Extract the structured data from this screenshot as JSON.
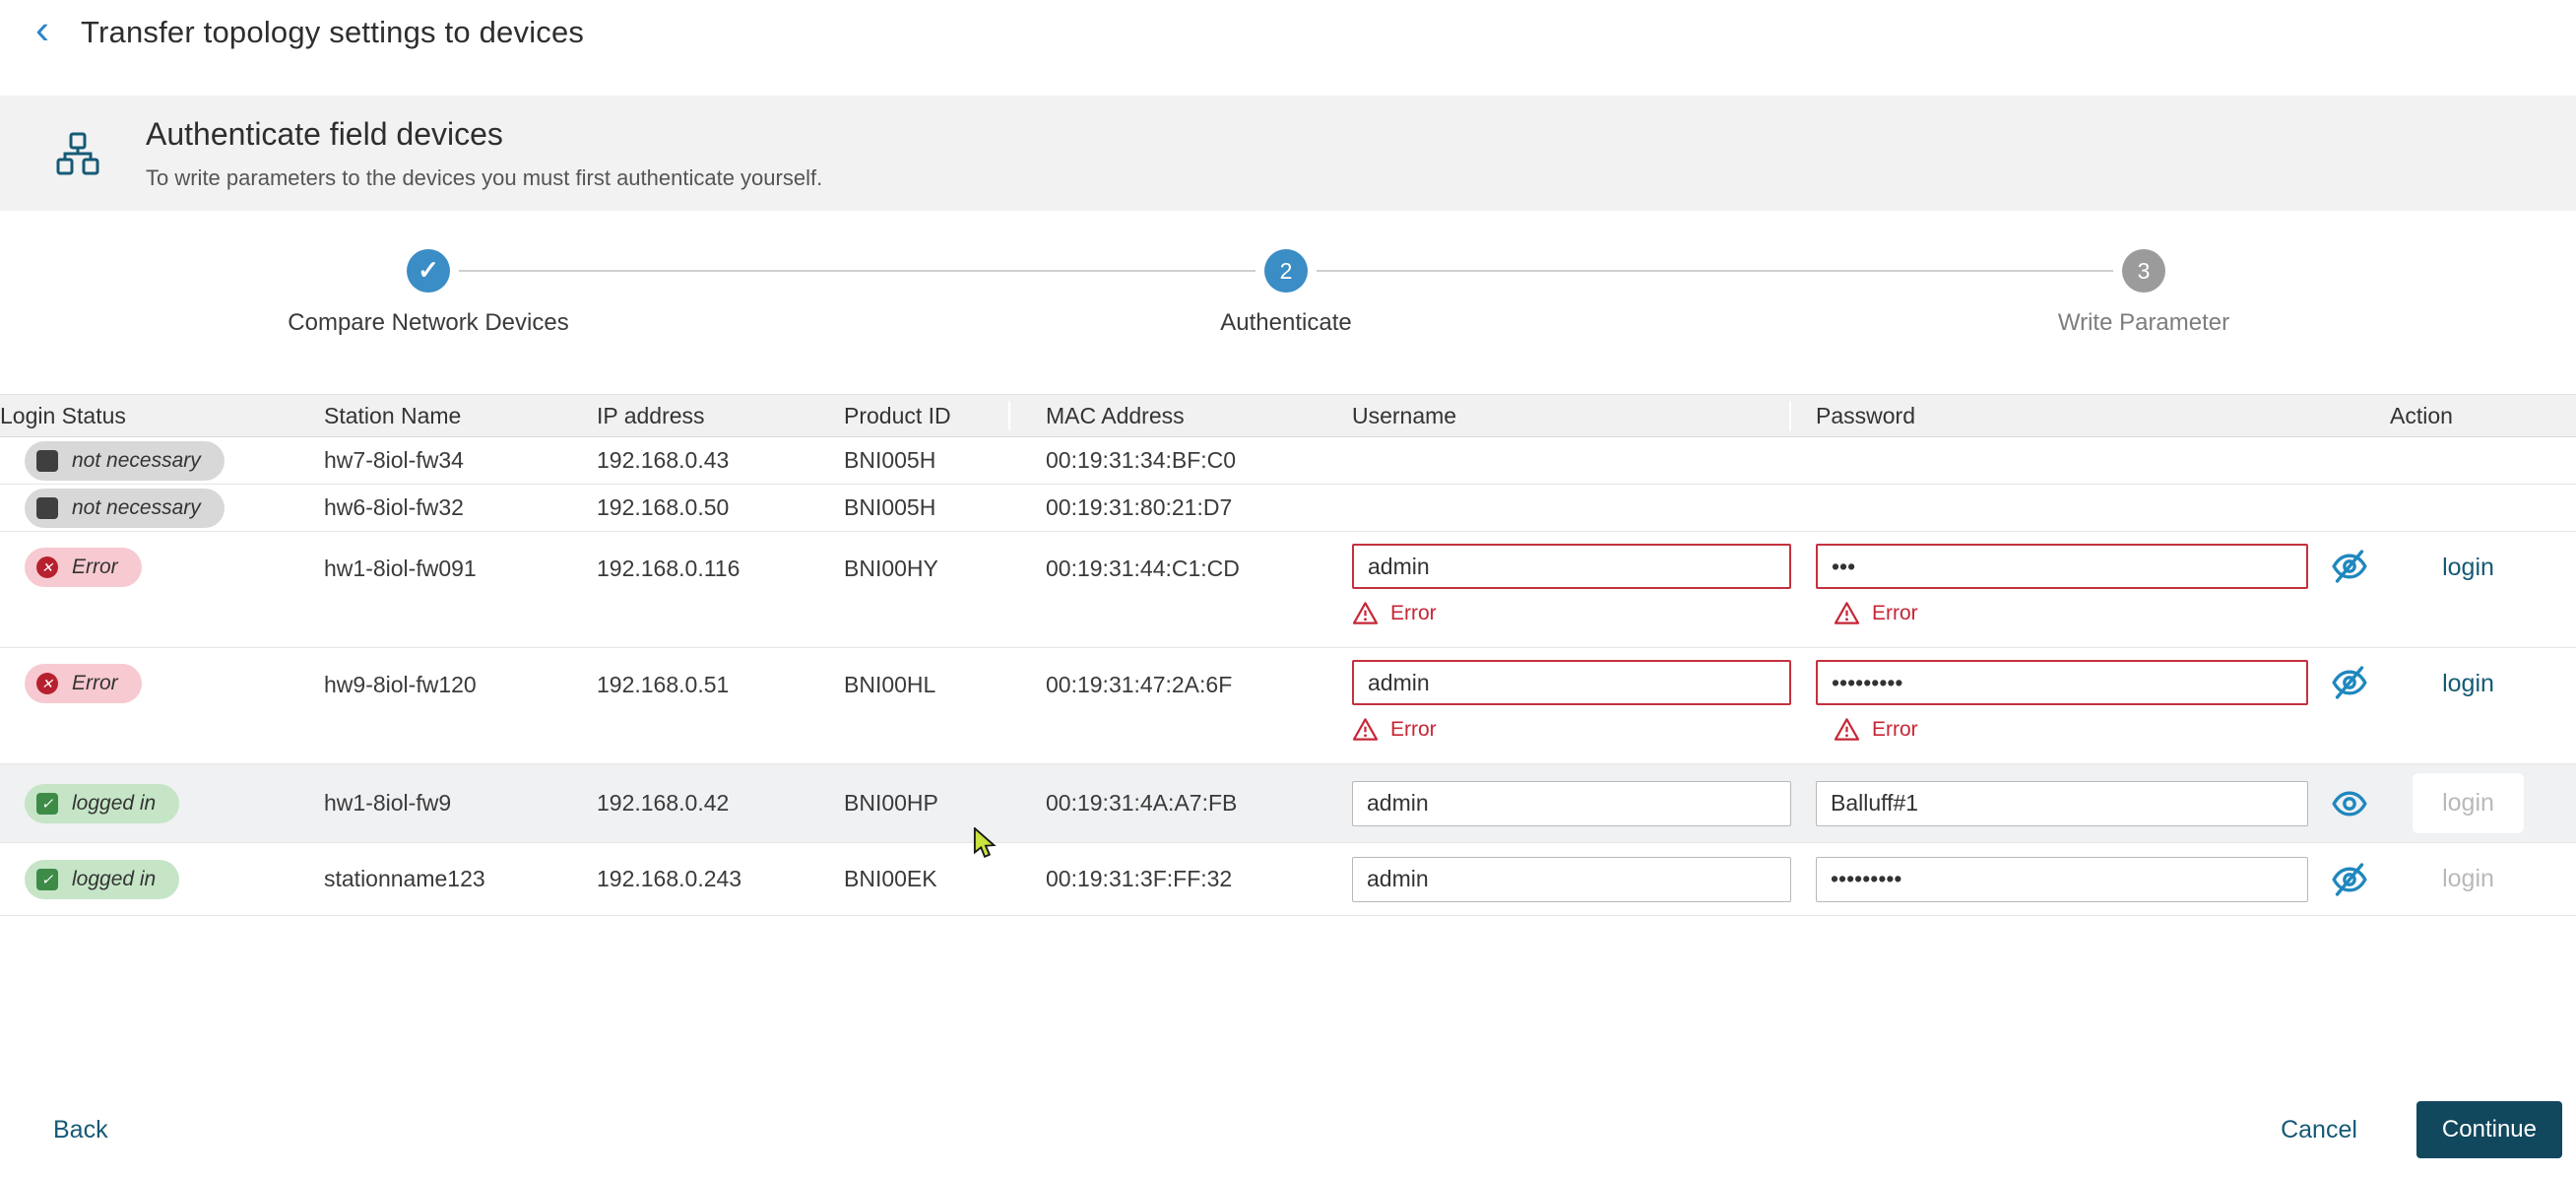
{
  "header": {
    "title": "Transfer topology settings to devices"
  },
  "banner": {
    "title": "Authenticate field devices",
    "subtitle": "To write parameters to the devices you must first authenticate yourself."
  },
  "stepper": {
    "steps": [
      {
        "label": "Compare Network Devices",
        "state": "done",
        "number": "1"
      },
      {
        "label": "Authenticate",
        "state": "active",
        "number": "2"
      },
      {
        "label": "Write Parameter",
        "state": "upcoming",
        "number": "3"
      }
    ]
  },
  "table": {
    "columns": [
      "Login Status",
      "Station Name",
      "IP address",
      "Product ID",
      "MAC Address",
      "Username",
      "Password",
      "Action"
    ],
    "rows": [
      {
        "status": {
          "label": "not necessary",
          "type": "not-necessary"
        },
        "station": "hw7-8iol-fw34",
        "ip": "192.168.0.43",
        "product": "BNI005H",
        "mac": "00:19:31:34:BF:C0",
        "username": null,
        "password": null,
        "eye": null,
        "action": null,
        "height": "h48",
        "highlight": false
      },
      {
        "status": {
          "label": "not necessary",
          "type": "not-necessary"
        },
        "station": "hw6-8iol-fw32",
        "ip": "192.168.0.50",
        "product": "BNI005H",
        "mac": "00:19:31:80:21:D7",
        "username": null,
        "password": null,
        "eye": null,
        "action": null,
        "height": "h48",
        "highlight": false
      },
      {
        "status": {
          "label": "Error",
          "type": "error"
        },
        "station": "hw1-8iol-fw091",
        "ip": "192.168.0.116",
        "product": "BNI00HY",
        "mac": "00:19:31:44:C1:CD",
        "username": {
          "value": "admin",
          "error": "Error"
        },
        "password": {
          "value": "•••",
          "error": "Error"
        },
        "eye": "eye-off",
        "action": {
          "label": "login",
          "enabled": true,
          "boxed": false
        },
        "height": "h118",
        "highlight": false
      },
      {
        "status": {
          "label": "Error",
          "type": "error"
        },
        "station": "hw9-8iol-fw120",
        "ip": "192.168.0.51",
        "product": "BNI00HL",
        "mac": "00:19:31:47:2A:6F",
        "username": {
          "value": "admin",
          "error": "Error"
        },
        "password": {
          "value": "•••••••••",
          "error": "Error"
        },
        "eye": "eye-off",
        "action": {
          "label": "login",
          "enabled": true,
          "boxed": false
        },
        "height": "h118",
        "highlight": false
      },
      {
        "status": {
          "label": "logged in",
          "type": "logged-in"
        },
        "station": "hw1-8iol-fw9",
        "ip": "192.168.0.42",
        "product": "BNI00HP",
        "mac": "00:19:31:4A:A7:FB",
        "username": {
          "value": "admin",
          "error": null
        },
        "password": {
          "value": "Balluff#1",
          "error": null
        },
        "eye": "eye",
        "action": {
          "label": "login",
          "enabled": false,
          "boxed": true
        },
        "height": "h80",
        "highlight": true
      },
      {
        "status": {
          "label": "logged in",
          "type": "logged-in"
        },
        "station": "stationname123",
        "ip": "192.168.0.243",
        "product": "BNI00EK",
        "mac": "00:19:31:3F:FF:32",
        "username": {
          "value": "admin",
          "error": null
        },
        "password": {
          "value": "•••••••••",
          "error": null
        },
        "eye": "eye-off",
        "action": {
          "label": "login",
          "enabled": false,
          "boxed": false
        },
        "height": "h74",
        "highlight": false
      }
    ]
  },
  "footer": {
    "back_label": "Back",
    "cancel_label": "Cancel",
    "continue_label": "Continue"
  },
  "icons": {
    "back": "chevron-left-icon",
    "banner": "network-topology-icon",
    "step_done": "check-icon",
    "status_not_necessary": "square-icon",
    "status_error": "circle-x-icon",
    "status_logged_in": "check-square-icon",
    "error_hint": "warning-triangle-icon",
    "password_hidden": "eye-off-icon",
    "password_visible": "eye-icon",
    "pointer": "mouse-cursor-icon"
  },
  "colors": {
    "accent_blue": "#3a8dc5",
    "link_teal": "#155a75",
    "continue_bg": "#12485e",
    "error_red": "#c62636",
    "error_pill": "#f7c9d0",
    "error_badge_icon": "#b7202e",
    "success_green": "#3d8b46",
    "success_pill": "#c5e5c6",
    "neutral_pill": "#d8d8d8",
    "banner_bg": "#f2f2f2",
    "header_row_bg": "#f1f1f1",
    "row_highlight": "#f0f1f3",
    "eye_icon_blue": "#1f87be"
  }
}
